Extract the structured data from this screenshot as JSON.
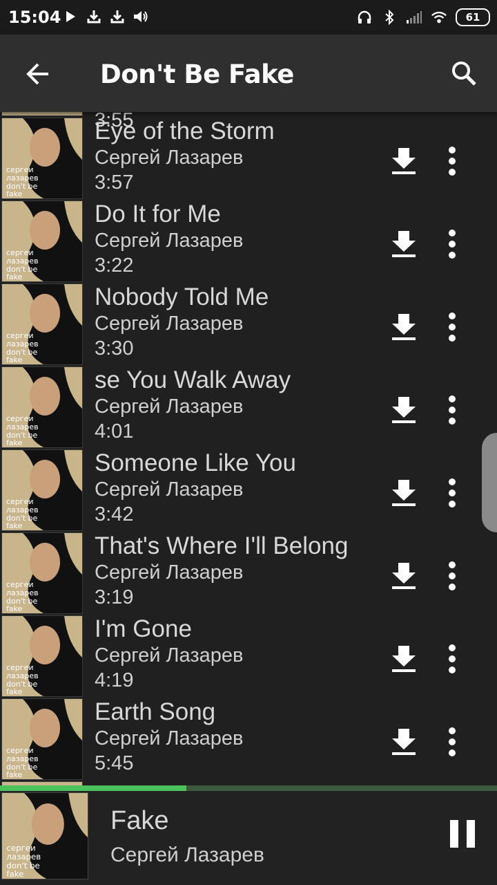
{
  "status_bar": {
    "time": "15:04",
    "battery": "61",
    "left_icons": [
      "play-icon",
      "download-icon",
      "download-icon",
      "volume-icon"
    ],
    "right_icons": [
      "headphones-icon",
      "bluetooth-icon",
      "signal-icon",
      "wifi-icon",
      "battery-icon"
    ]
  },
  "app_bar": {
    "title": "Don't Be Fake",
    "back_icon": "arrow-back-icon",
    "search_icon": "search-icon"
  },
  "album_art_text": [
    "сергеи",
    "лазарев",
    "don't be",
    "fake"
  ],
  "partial_top_duration": "3:55",
  "tracks": [
    {
      "title": "Eye of the Storm",
      "artist": "Сергей Лазарев",
      "duration": "3:57"
    },
    {
      "title": "Do It for Me",
      "artist": "Сергей Лазарев",
      "duration": "3:22"
    },
    {
      "title": "Nobody Told Me",
      "artist": "Сергей Лазарев",
      "duration": "3:30"
    },
    {
      "title": "se You Walk Away",
      "artist": "Сергей Лазарев",
      "duration": "4:01"
    },
    {
      "title": "Someone Like You",
      "artist": "Сергей Лазарев",
      "duration": "3:42"
    },
    {
      "title": "That's Where I'll Belong",
      "artist": "Сергей Лазарев",
      "duration": "3:19"
    },
    {
      "title": "I'm Gone",
      "artist": "Сергей Лазарев",
      "duration": "4:19"
    },
    {
      "title": "Earth Song",
      "artist": "Сергей Лазарев",
      "duration": "5:45"
    }
  ],
  "now_playing": {
    "title": "Fake",
    "artist": "Сергей Лазарев",
    "progress_percent": 37.5,
    "state_icon": "pause-icon"
  },
  "colors": {
    "background": "#202020",
    "app_bar": "#2f2f2f",
    "progress_fill": "#4cc25a",
    "progress_track": "#3d5a3f",
    "album_art": "#c9b58c"
  }
}
